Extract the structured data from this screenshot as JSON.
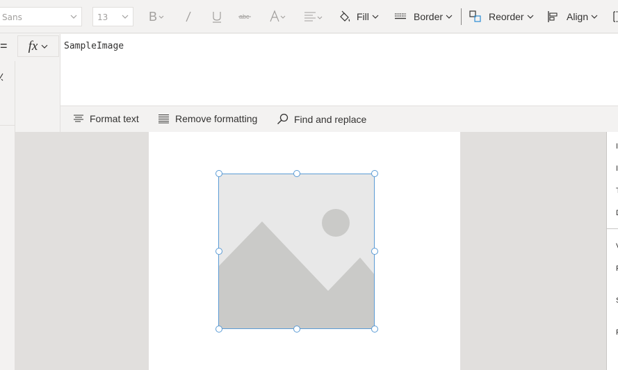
{
  "ribbon": {
    "font_family": "Sans",
    "font_size": "13",
    "fill_label": "Fill",
    "border_label": "Border",
    "reorder_label": "Reorder",
    "align_label": "Align"
  },
  "formula_bar": {
    "equals": "=",
    "fx_label": "fx",
    "formula": "SampleImage",
    "tools": {
      "format_text": "Format text",
      "remove_formatting": "Remove formatting",
      "find_replace": "Find and replace"
    }
  },
  "right_panel": {
    "truncated_labels": [
      "I",
      "I",
      "T",
      "D",
      "V",
      "F",
      "S",
      "F"
    ]
  },
  "colors": {
    "accent_selection": "#5b9bd5",
    "placeholder_shape": "#cacac8",
    "placeholder_bg": "#e8e8e8",
    "canvas_bg": "#e1dfdd"
  }
}
